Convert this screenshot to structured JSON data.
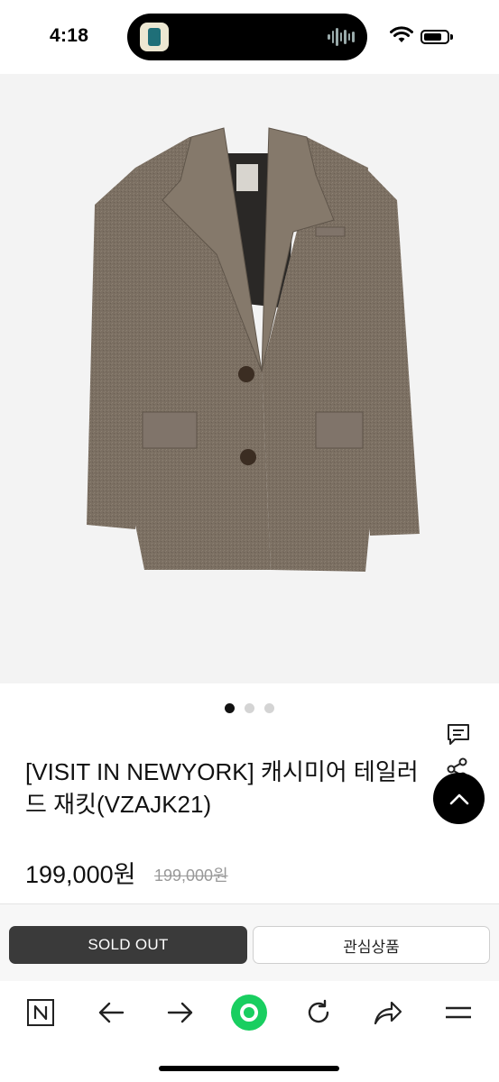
{
  "status_bar": {
    "time": "4:18",
    "battery_level": 0.8
  },
  "product": {
    "title": "[VISIT IN NEWYORK] 캐시미어 테일러드 재킷(VZAJK21)",
    "price": "199,000원",
    "original_price": "199,000원",
    "image_count": 3,
    "active_image_index": 0,
    "jacket_color": "#7b6f62"
  },
  "actions": {
    "sold_out_label": "SOLD OUT",
    "wishlist_label": "관심상품"
  },
  "browser_bar": {
    "items": [
      {
        "icon": "naver-n-icon"
      },
      {
        "icon": "back-arrow-icon"
      },
      {
        "icon": "forward-arrow-icon"
      },
      {
        "icon": "green-home-icon"
      },
      {
        "icon": "refresh-icon"
      },
      {
        "icon": "share-icon"
      },
      {
        "icon": "menu-icon"
      }
    ],
    "accent_color": "#19ce60"
  }
}
